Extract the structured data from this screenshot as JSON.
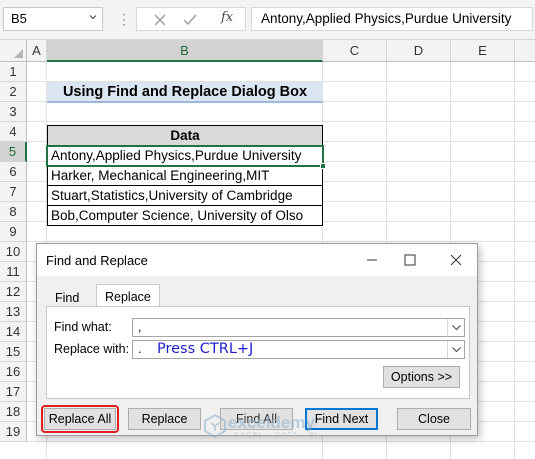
{
  "formula_bar": {
    "name_box": "B5",
    "fx": "fx",
    "formula": "Antony,Applied Physics,Purdue University"
  },
  "columns": [
    "A",
    "B",
    "C",
    "D",
    "E"
  ],
  "selected_column": "B",
  "rows": [
    "1",
    "2",
    "3",
    "4",
    "5",
    "6",
    "7",
    "8",
    "9",
    "10",
    "11",
    "12",
    "13",
    "14",
    "15",
    "16",
    "17",
    "18",
    "19"
  ],
  "selected_row": "5",
  "title": "Using Find and Replace Dialog Box",
  "table": {
    "header": "Data",
    "rows": [
      "Antony,Applied Physics,Purdue University",
      "Harker, Mechanical Engineering,MIT",
      "Stuart,Statistics,University of Cambridge",
      "Bob,Computer Science, University of Olso"
    ]
  },
  "dialog": {
    "title": "Find and Replace",
    "tabs": {
      "find": "Find",
      "replace": "Replace"
    },
    "active_tab": "Replace",
    "find_what_label": "Find what:",
    "find_what_value": ",",
    "replace_with_label": "Replace with:",
    "replace_with_value": ".",
    "note": "Press CTRL+J",
    "note_color": "#1f1fd1",
    "buttons": {
      "options": "Options >>",
      "replace_all": "Replace All",
      "replace": "Replace",
      "find_all": "Find All",
      "find_next": "Find Next",
      "close": "Close"
    },
    "highlight_color": "#e02020"
  },
  "watermark": {
    "name": "exceldemy",
    "tagline": "EXCEL · DATA · BI"
  },
  "colors": {
    "accent": "#217346",
    "title_fill": "#dce6f2",
    "header_fill": "#d9d9d9"
  }
}
